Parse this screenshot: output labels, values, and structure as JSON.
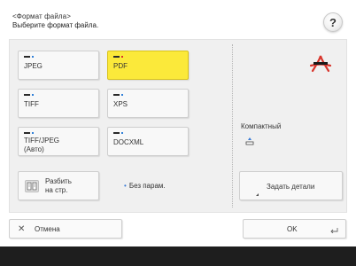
{
  "header": {
    "title": "<Формат файла>",
    "subtitle": "Выберите формат файла."
  },
  "help": {
    "label": "?"
  },
  "formats": [
    {
      "label": "JPEG",
      "selected": false,
      "indicator_color": "#2f7fd8"
    },
    {
      "label": "PDF",
      "selected": true,
      "indicator_color": "#d8342b"
    },
    {
      "label": "TIFF",
      "selected": false,
      "indicator_color": "#2f7fd8"
    },
    {
      "label": "XPS",
      "selected": false,
      "indicator_color": "#2f7fd8"
    },
    {
      "label": "TIFF/JPEG",
      "label2": "(Авто)",
      "selected": false,
      "indicator_color": "#2f7fd8"
    },
    {
      "label": "DOCXML",
      "selected": false,
      "indicator_color": "#2f7fd8"
    }
  ],
  "split": {
    "label1": "Разбить",
    "label2": "на стр.",
    "value": "Без парам."
  },
  "compact": {
    "label": "Компактный"
  },
  "details": {
    "label": "Задать детали"
  },
  "footer": {
    "cancel_label": "Отмена",
    "ok_label": "OK"
  },
  "colors": {
    "accent_yellow": "#fbe93a",
    "adobe_red": "#d8342b",
    "bottom_bar": "#1e1e1e"
  },
  "icons": {
    "help": "help-icon",
    "split": "split-pages-icon",
    "adobe": "adobe-pdf-icon",
    "compact_state": "compact-state-icon",
    "cancel": "close-icon",
    "ok": "enter-icon"
  }
}
